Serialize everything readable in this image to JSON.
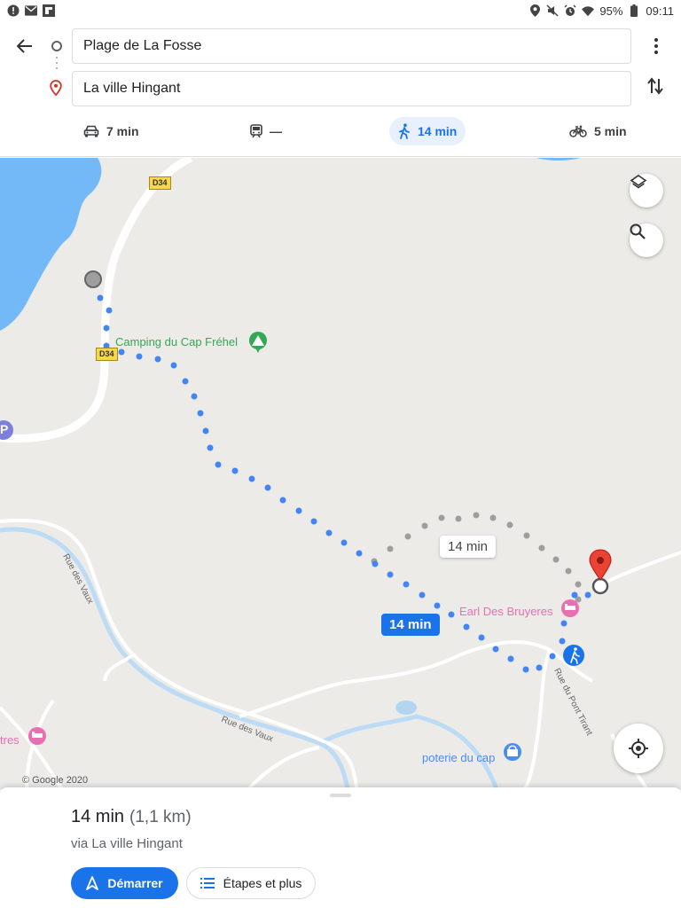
{
  "status": {
    "battery": "95%",
    "time": "09:11"
  },
  "search": {
    "origin": "Plage de La Fosse",
    "destination": "La ville Hingant"
  },
  "modes": [
    {
      "name": "car",
      "icon": "car-icon",
      "time": "7 min"
    },
    {
      "name": "transit",
      "icon": "train-icon",
      "time": "—"
    },
    {
      "name": "walking",
      "icon": "walk-icon",
      "time": "14 min",
      "active": true
    },
    {
      "name": "bike",
      "icon": "bike-icon",
      "time": "5 min"
    }
  ],
  "map": {
    "road_label": "D34",
    "poi_camping": "Camping du Cap Fréhel",
    "poi_earl": "Earl Des Bruyeres",
    "poi_poterie": "poterie du cap",
    "poi_partial": "tres",
    "street_vaux_1": "Rue des Vaux",
    "street_vaux_2": "Rue des Vaux",
    "street_pont": "Rue du Pont Tirant",
    "route_main_time": "14 min",
    "route_alt_time": "14 min",
    "parking_label": "P",
    "copyright": "© Google 2020",
    "colors": {
      "route": "#4285f4",
      "alt_route": "#9e9e9e",
      "water": "#74b9f7",
      "poi_green": "#34a853",
      "poi_pink": "#e86fb0"
    }
  },
  "sheet": {
    "duration": "14 min",
    "distance": "(1,1 km)",
    "via": "via La ville Hingant",
    "start_label": "Démarrer",
    "steps_label": "Étapes et plus"
  }
}
